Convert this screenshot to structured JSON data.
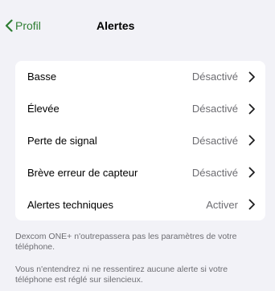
{
  "nav": {
    "back_label": "Profil",
    "title": "Alertes"
  },
  "alerts": [
    {
      "label": "Basse",
      "value": "Désactivé"
    },
    {
      "label": "Élevée",
      "value": "Désactivé"
    },
    {
      "label": "Perte de signal",
      "value": "Désactivé"
    },
    {
      "label": "Brève erreur de capteur",
      "value": "Désactivé"
    },
    {
      "label": "Alertes techniques",
      "value": "Activer"
    }
  ],
  "footer": {
    "note_1": "Dexcom ONE+ n'outrepassera pas les paramètres de votre téléphone.",
    "note_2": "Vous n'entendrez ni ne ressentirez aucune alerte si votre téléphone est réglé sur silencieux."
  },
  "colors": {
    "accent": "#2e7d32",
    "background": "#f2f2f7",
    "card": "#ffffff",
    "secondary_text": "#6d6d72"
  },
  "icons": {
    "back": "chevron-left-icon",
    "row": "chevron-right-icon"
  }
}
